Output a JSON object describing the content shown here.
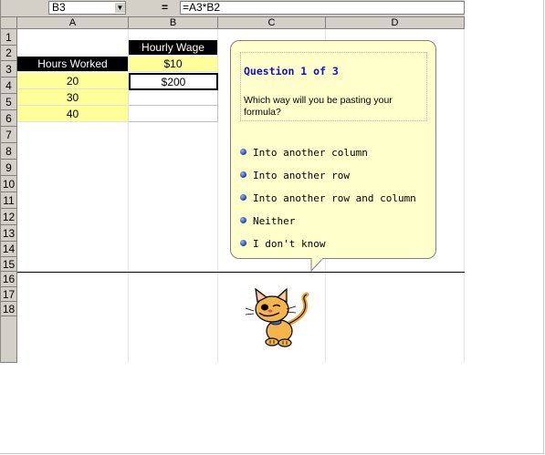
{
  "formula_bar": {
    "name_box": "B3",
    "equals": "=",
    "formula": "=A3*B2"
  },
  "columns": [
    "A",
    "B",
    "C",
    "D"
  ],
  "rows": [
    "1",
    "2",
    "3",
    "4",
    "5",
    "6",
    "7",
    "8",
    "9",
    "10",
    "11",
    "12",
    "13",
    "14",
    "15",
    "16",
    "17",
    "18"
  ],
  "cells": {
    "B1": "Hourly Wage",
    "A2": "Hours Worked",
    "B2": "$10",
    "A3": "20",
    "B3": "$200",
    "A4": "30",
    "A5": "40"
  },
  "assistant": {
    "title": "Question 1 of 3",
    "question": "Which way will you be pasting your formula?",
    "options": [
      "Into another column",
      "Into another row",
      "Into another row and column",
      "Neither",
      "I don't know"
    ],
    "character": "cat-assistant-icon"
  },
  "colors": {
    "highlight": "#ffff99",
    "bubble": "#ffffcc",
    "title": "#1010c0"
  }
}
